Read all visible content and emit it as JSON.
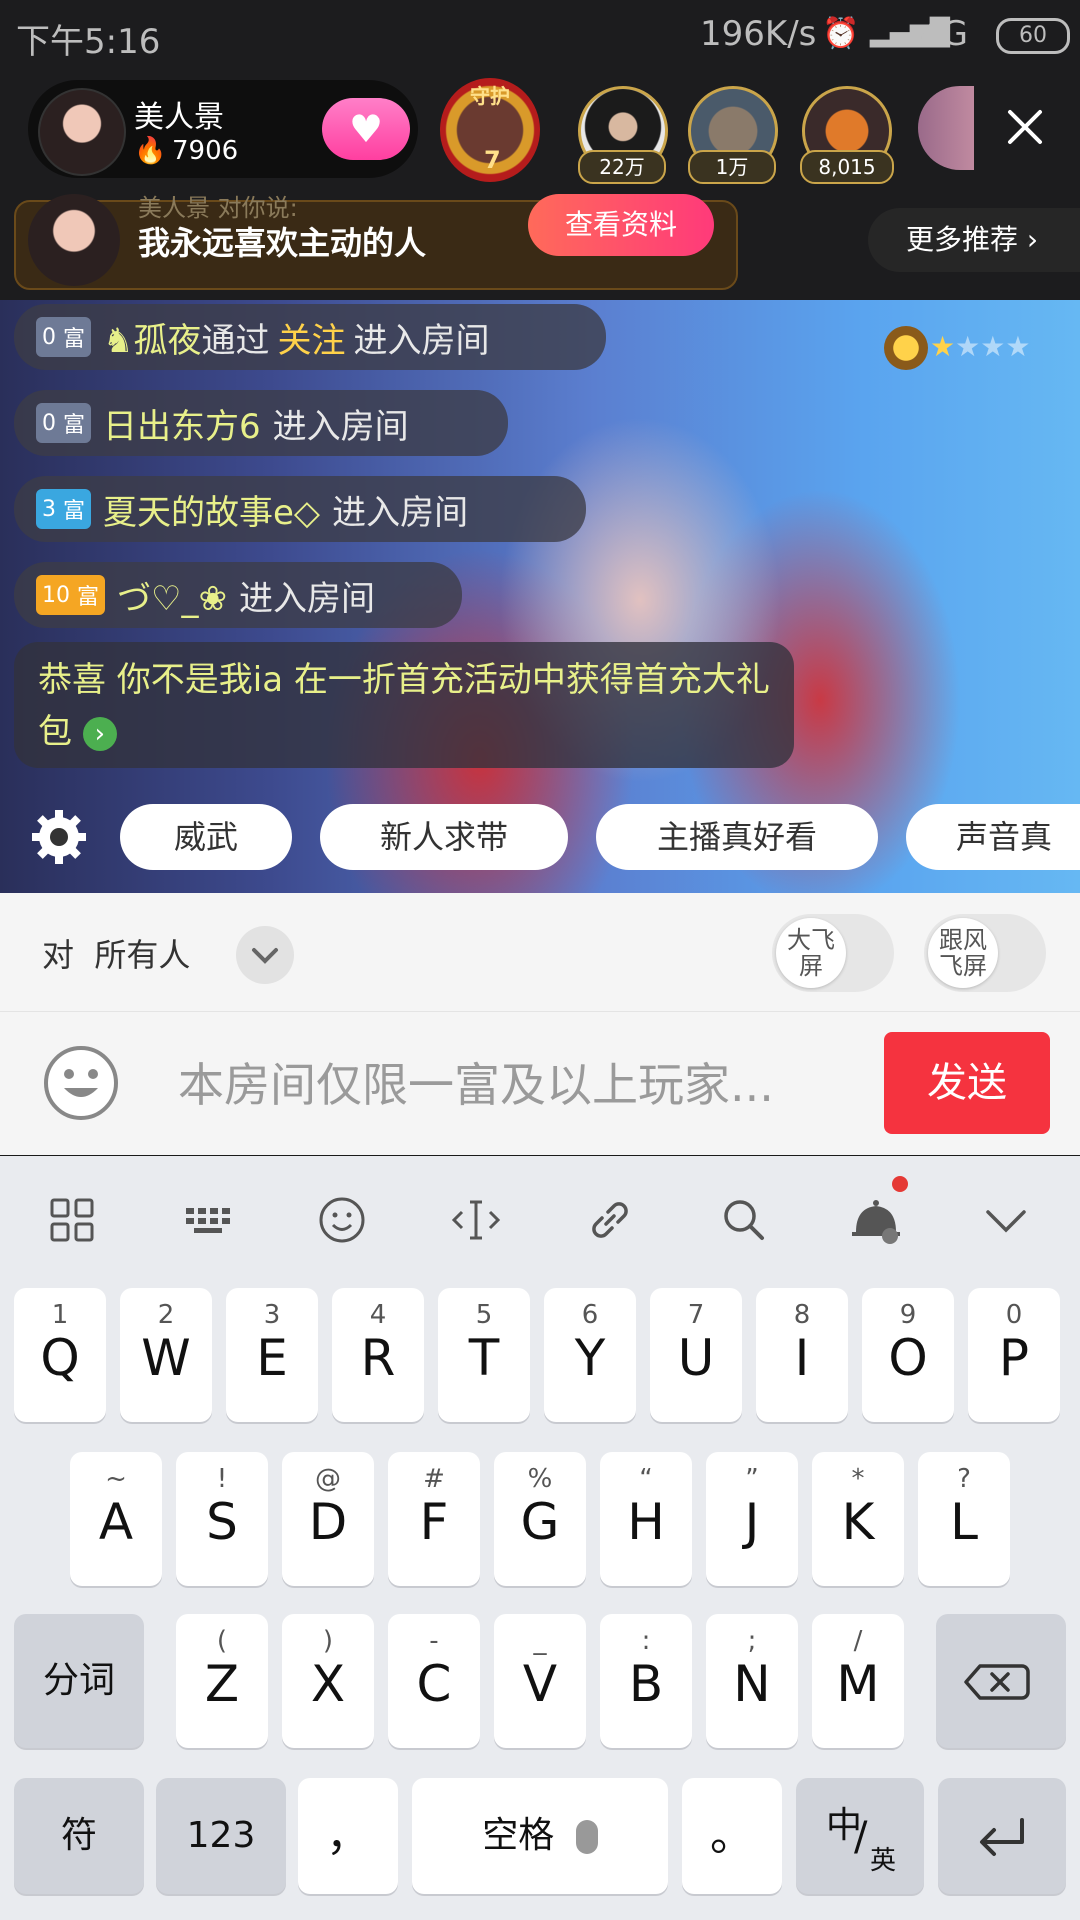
{
  "status_bar": {
    "time": "下午5:16",
    "net_speed": "196K/s",
    "signal": "4G",
    "battery": "60"
  },
  "streamer": {
    "name": "美人景",
    "heat": "7906"
  },
  "guard_badge": {
    "label": "守护",
    "count": "7"
  },
  "viewers": [
    {
      "count": "22万"
    },
    {
      "count": "1万"
    },
    {
      "count": "8,015"
    }
  ],
  "invite": {
    "faded_text": "美人景 对你说:",
    "message": "我永远喜欢主动的人",
    "view_profile_label": "查看资料",
    "more_label": "更多推荐 ›"
  },
  "chat": {
    "rich_suffix": "富",
    "enter_text": "进入房间",
    "messages": [
      {
        "rich": "0",
        "name": "♞孤夜",
        "via": "通过",
        "action": "关注",
        "badge_color": "#6e7a96"
      },
      {
        "rich": "0",
        "name": "日出东方6",
        "badge_color": "#6e7a96"
      },
      {
        "rich": "3",
        "name": "夏天的故事e◇",
        "badge_color": "#3aa7e0"
      },
      {
        "rich": "10",
        "name": "づ♡_❀",
        "badge_color": "#f5a623"
      }
    ],
    "congrats": "恭喜 你不是我ia 在一折首充活动中获得首充大礼包"
  },
  "quick_replies": [
    "威武",
    "新人求带",
    "主播真好看",
    "声音真好"
  ],
  "target": {
    "prefix": "对",
    "value": "所有人",
    "toggle_big": "大飞屏",
    "toggle_follow": "跟风飞屏"
  },
  "composer": {
    "placeholder": "本房间仅限一富及以上玩家...",
    "send_label": "发送"
  },
  "keyboard": {
    "row1": [
      {
        "k": "Q",
        "s": "1"
      },
      {
        "k": "W",
        "s": "2"
      },
      {
        "k": "E",
        "s": "3"
      },
      {
        "k": "R",
        "s": "4"
      },
      {
        "k": "T",
        "s": "5"
      },
      {
        "k": "Y",
        "s": "6"
      },
      {
        "k": "U",
        "s": "7"
      },
      {
        "k": "I",
        "s": "8"
      },
      {
        "k": "O",
        "s": "9"
      },
      {
        "k": "P",
        "s": "0"
      }
    ],
    "row2": [
      {
        "k": "A",
        "s": "~"
      },
      {
        "k": "S",
        "s": "!"
      },
      {
        "k": "D",
        "s": "@"
      },
      {
        "k": "F",
        "s": "#"
      },
      {
        "k": "G",
        "s": "%"
      },
      {
        "k": "H",
        "s": "“"
      },
      {
        "k": "J",
        "s": "”"
      },
      {
        "k": "K",
        "s": "*"
      },
      {
        "k": "L",
        "s": "?"
      }
    ],
    "row3": [
      {
        "k": "Z",
        "s": "("
      },
      {
        "k": "X",
        "s": ")"
      },
      {
        "k": "C",
        "s": "-"
      },
      {
        "k": "V",
        "s": "_"
      },
      {
        "k": "B",
        "s": ":"
      },
      {
        "k": "N",
        "s": ";"
      },
      {
        "k": "M",
        "s": "/"
      }
    ],
    "segment_label": "分词",
    "symbol_label": "符",
    "num_label": "123",
    "comma": "，",
    "space_label": "空格",
    "period": "。",
    "lang_main": "中",
    "lang_sub": "英"
  }
}
